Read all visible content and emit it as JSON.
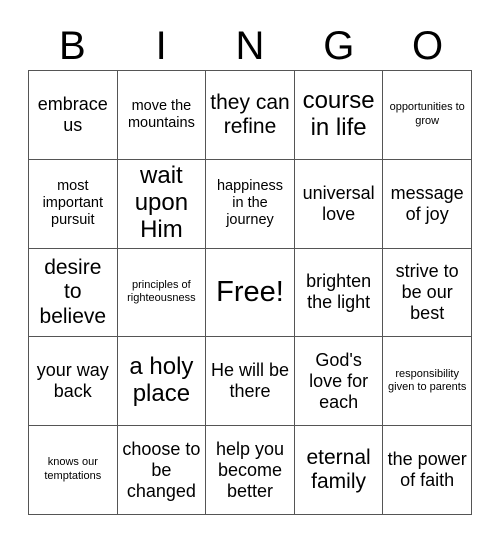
{
  "card": {
    "title_letters": [
      "B",
      "I",
      "N",
      "G",
      "O"
    ],
    "free_space_label": "Free!",
    "rows": [
      [
        {
          "text": "embrace us",
          "size": "md"
        },
        {
          "text": "move the mountains",
          "size": "sm"
        },
        {
          "text": "they can refine",
          "size": "lg"
        },
        {
          "text": "course in life",
          "size": "xl"
        },
        {
          "text": "opportunities to grow",
          "size": "xs"
        }
      ],
      [
        {
          "text": "most important pursuit",
          "size": "sm"
        },
        {
          "text": "wait upon Him",
          "size": "xl"
        },
        {
          "text": "happiness in the journey",
          "size": "sm"
        },
        {
          "text": "universal love",
          "size": "md"
        },
        {
          "text": "message of joy",
          "size": "md"
        }
      ],
      [
        {
          "text": "desire to believe",
          "size": "lg"
        },
        {
          "text": "principles of righteousness",
          "size": "xs"
        },
        {
          "text": "Free!",
          "size": "free"
        },
        {
          "text": "brighten the light",
          "size": "md"
        },
        {
          "text": "strive to be our best",
          "size": "md"
        }
      ],
      [
        {
          "text": "your way back",
          "size": "md"
        },
        {
          "text": "a holy place",
          "size": "xl"
        },
        {
          "text": "He will be there",
          "size": "md"
        },
        {
          "text": "God's love for each",
          "size": "md"
        },
        {
          "text": "responsibility given to parents",
          "size": "xs"
        }
      ],
      [
        {
          "text": "knows our temptations",
          "size": "xs"
        },
        {
          "text": "choose to be changed",
          "size": "md"
        },
        {
          "text": "help you become better",
          "size": "md"
        },
        {
          "text": "eternal family",
          "size": "lg"
        },
        {
          "text": "the power of faith",
          "size": "md"
        }
      ]
    ]
  }
}
